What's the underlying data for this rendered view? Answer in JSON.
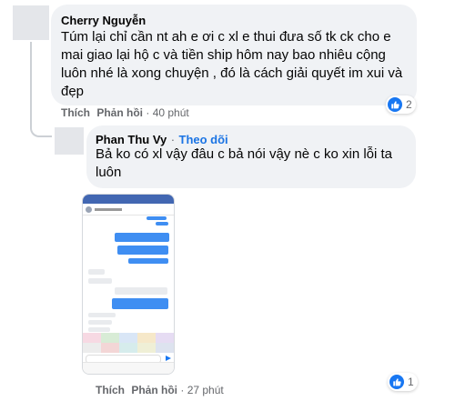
{
  "comment1": {
    "author": "Cherry Nguyễn",
    "text_lines": [
      "Túm lại chỉ cần nt ah e ơi c xl e thui đưa số tk ck cho e",
      "mai giao lại hộ c và tiền ship hôm nay bao nhiêu cộng",
      "luôn nhé là xong chuyện , đó là cách giải quyết im xui và",
      "đẹp"
    ],
    "like_label": "Thích",
    "reply_label": "Phản hồi",
    "time": "40 phút",
    "reaction_count": "2"
  },
  "comment2": {
    "author": "Phan Thu Vy",
    "separator": "·",
    "follow_label": "Theo dõi",
    "text_lines": [
      "Bả ko có xl vậy đâu c bả nói vậy nè c ko xin lỗi ta",
      "luôn"
    ],
    "like_label": "Thích",
    "reply_label": "Phản hồi",
    "time": "27 phút",
    "reaction_count": "1",
    "attachment": {
      "kind": "chat-screenshot"
    }
  },
  "icons": {
    "like": "thumbs-up-icon"
  },
  "colors": {
    "link": "#1b74e4",
    "like": "#1877f2",
    "bubble": "#f0f2f5",
    "meta": "#65676b"
  }
}
